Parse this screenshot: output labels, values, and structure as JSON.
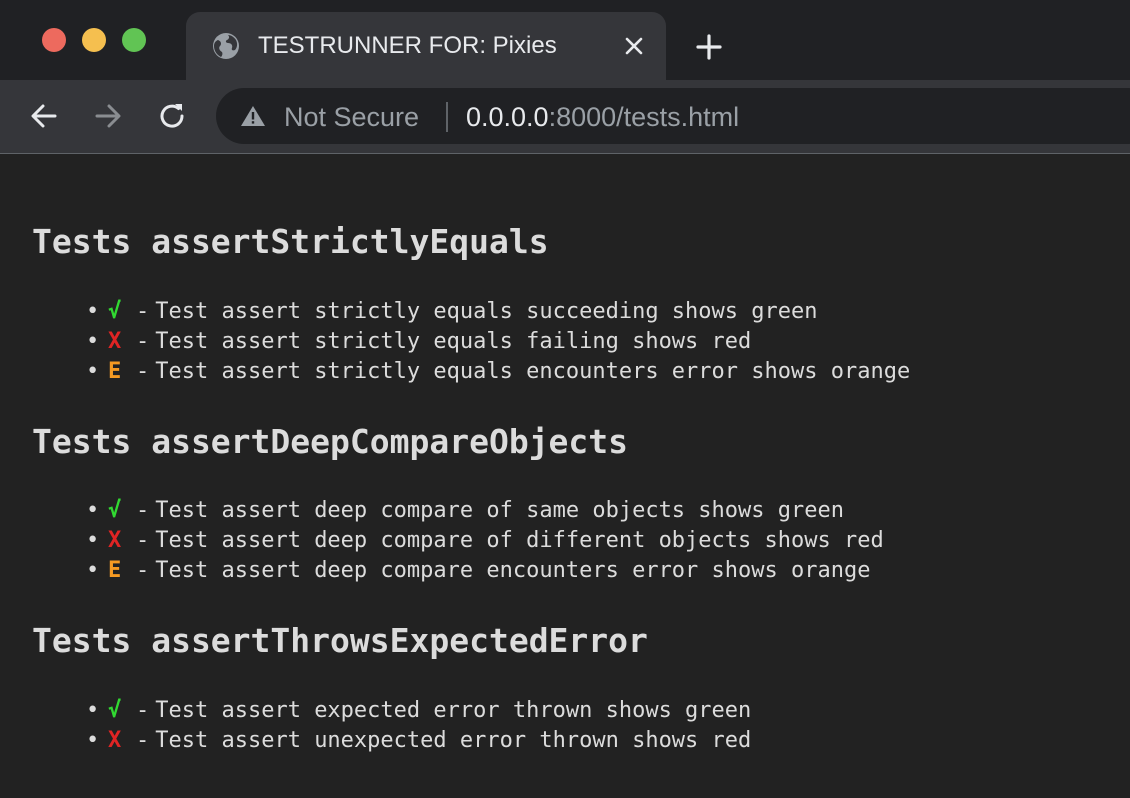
{
  "browser": {
    "tab": {
      "title": "TESTRUNNER FOR: Pixies",
      "icon": "globe-icon"
    },
    "address_bar": {
      "security_label": "Not Secure",
      "url_host": "0.0.0.0",
      "url_rest": ":8000/tests.html"
    }
  },
  "colors": {
    "pass": "#31d931",
    "fail": "#e02424",
    "error": "#f59a23"
  },
  "suites": [
    {
      "title": "Tests assertStrictlyEquals",
      "tests": [
        {
          "status": "pass",
          "mark": "√",
          "separator": "-",
          "label": "Test assert strictly equals succeeding shows green"
        },
        {
          "status": "fail",
          "mark": "X",
          "separator": "-",
          "label": "Test assert strictly equals failing shows red"
        },
        {
          "status": "error",
          "mark": "E",
          "separator": "-",
          "label": "Test assert strictly equals encounters error shows orange"
        }
      ]
    },
    {
      "title": "Tests assertDeepCompareObjects",
      "tests": [
        {
          "status": "pass",
          "mark": "√",
          "separator": "-",
          "label": "Test assert deep compare of same objects shows green"
        },
        {
          "status": "fail",
          "mark": "X",
          "separator": "-",
          "label": "Test assert deep compare of different objects shows red"
        },
        {
          "status": "error",
          "mark": "E",
          "separator": "-",
          "label": "Test assert deep compare encounters error shows orange"
        }
      ]
    },
    {
      "title": "Tests assertThrowsExpectedError",
      "tests": [
        {
          "status": "pass",
          "mark": "√",
          "separator": "-",
          "label": "Test assert expected error thrown shows green"
        },
        {
          "status": "fail",
          "mark": "X",
          "separator": "-",
          "label": "Test assert unexpected error thrown shows red"
        }
      ]
    }
  ]
}
